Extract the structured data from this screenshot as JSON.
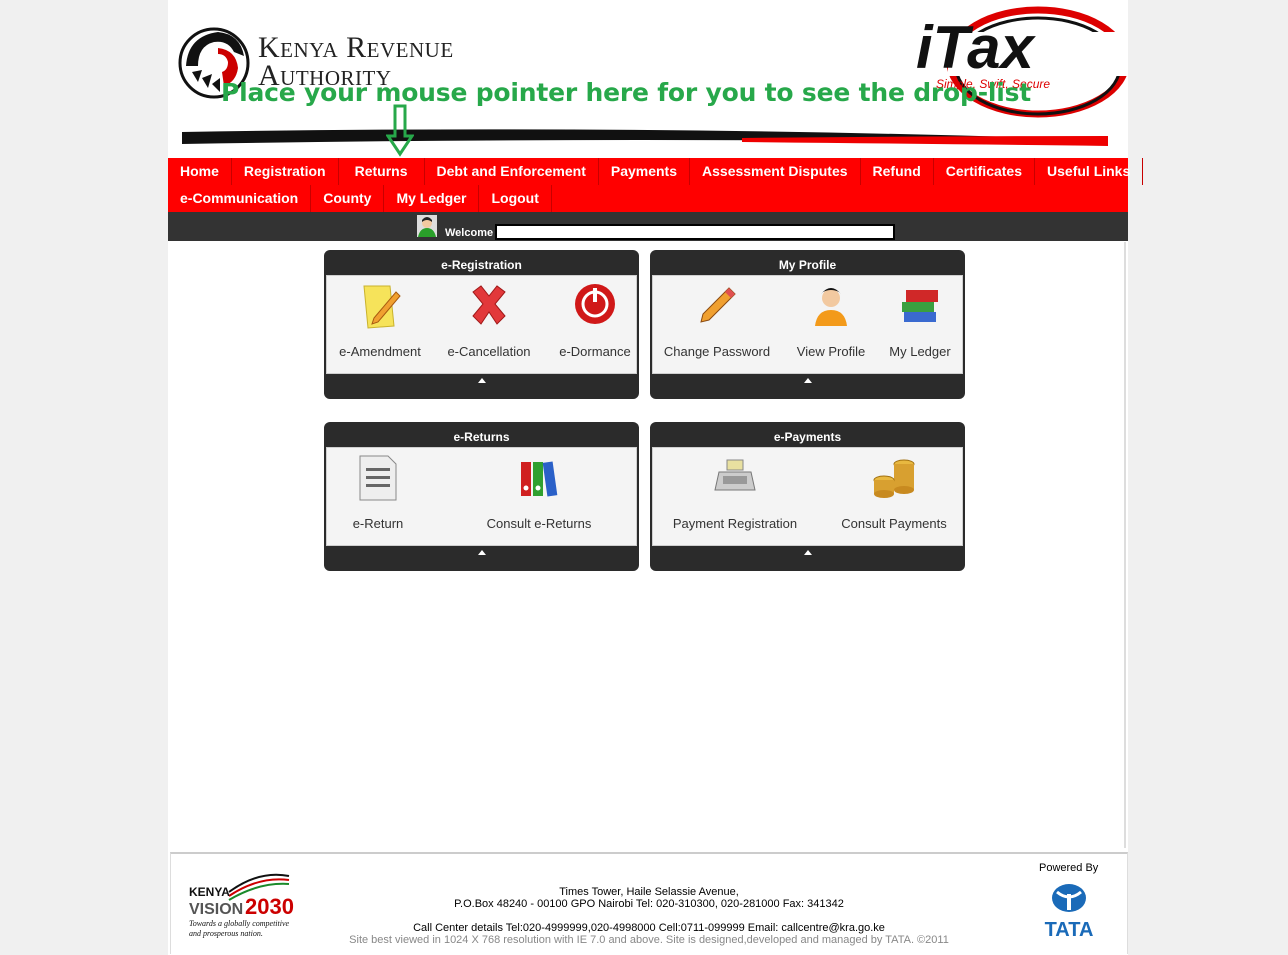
{
  "header": {
    "org_line1": "Kenya Revenue",
    "org_line2": "Authority",
    "itax_brand": "iTax",
    "itax_tagline": "Simple, Swift, Secure",
    "hint": "Place your mouse pointer here for you to see the drop-list"
  },
  "nav": {
    "row1": [
      "Home",
      "Registration",
      "Returns",
      "Debt and Enforcement",
      "Payments",
      "Assessment Disputes",
      "Refund",
      "Certificates",
      "Useful Links"
    ],
    "row2": [
      "e-Communication",
      "County",
      "My Ledger",
      "Logout"
    ]
  },
  "welcome": {
    "label": "Welcome"
  },
  "panels": {
    "registration": {
      "title": "e-Registration",
      "items": [
        "e-Amendment",
        "e-Cancellation",
        "e-Dormance"
      ]
    },
    "profile": {
      "title": "My Profile",
      "items": [
        "Change Password",
        "View Profile",
        "My Ledger"
      ]
    },
    "returns": {
      "title": "e-Returns",
      "items": [
        "e-Return",
        "Consult e-Returns"
      ]
    },
    "payments": {
      "title": "e-Payments",
      "items": [
        "Payment Registration",
        "Consult Payments"
      ]
    }
  },
  "footer": {
    "address1": "Times Tower, Haile Selassie Avenue,",
    "address2": "P.O.Box 48240 - 00100 GPO Nairobi Tel: 020-310300, 020-281000 Fax: 341342",
    "callcenter": "Call Center details Tel:020-4999999,020-4998000 Cell:0711-099999 Email: callcentre@kra.go.ke",
    "copyright": "Site best viewed in 1024 X 768 resolution with IE 7.0 and above. Site is designed,developed and managed by TATA. ©2011",
    "powered_by": "Powered By",
    "tata": "TATA",
    "vision_kenya": "KENYA",
    "vision_word": "VISION",
    "vision_year": "2030",
    "vision_tag1": "Towards a globally competitive",
    "vision_tag2": "and prosperous nation."
  },
  "colors": {
    "nav_red": "#ff0000",
    "dark_bar": "#333333",
    "hint_green": "#27a84a"
  }
}
